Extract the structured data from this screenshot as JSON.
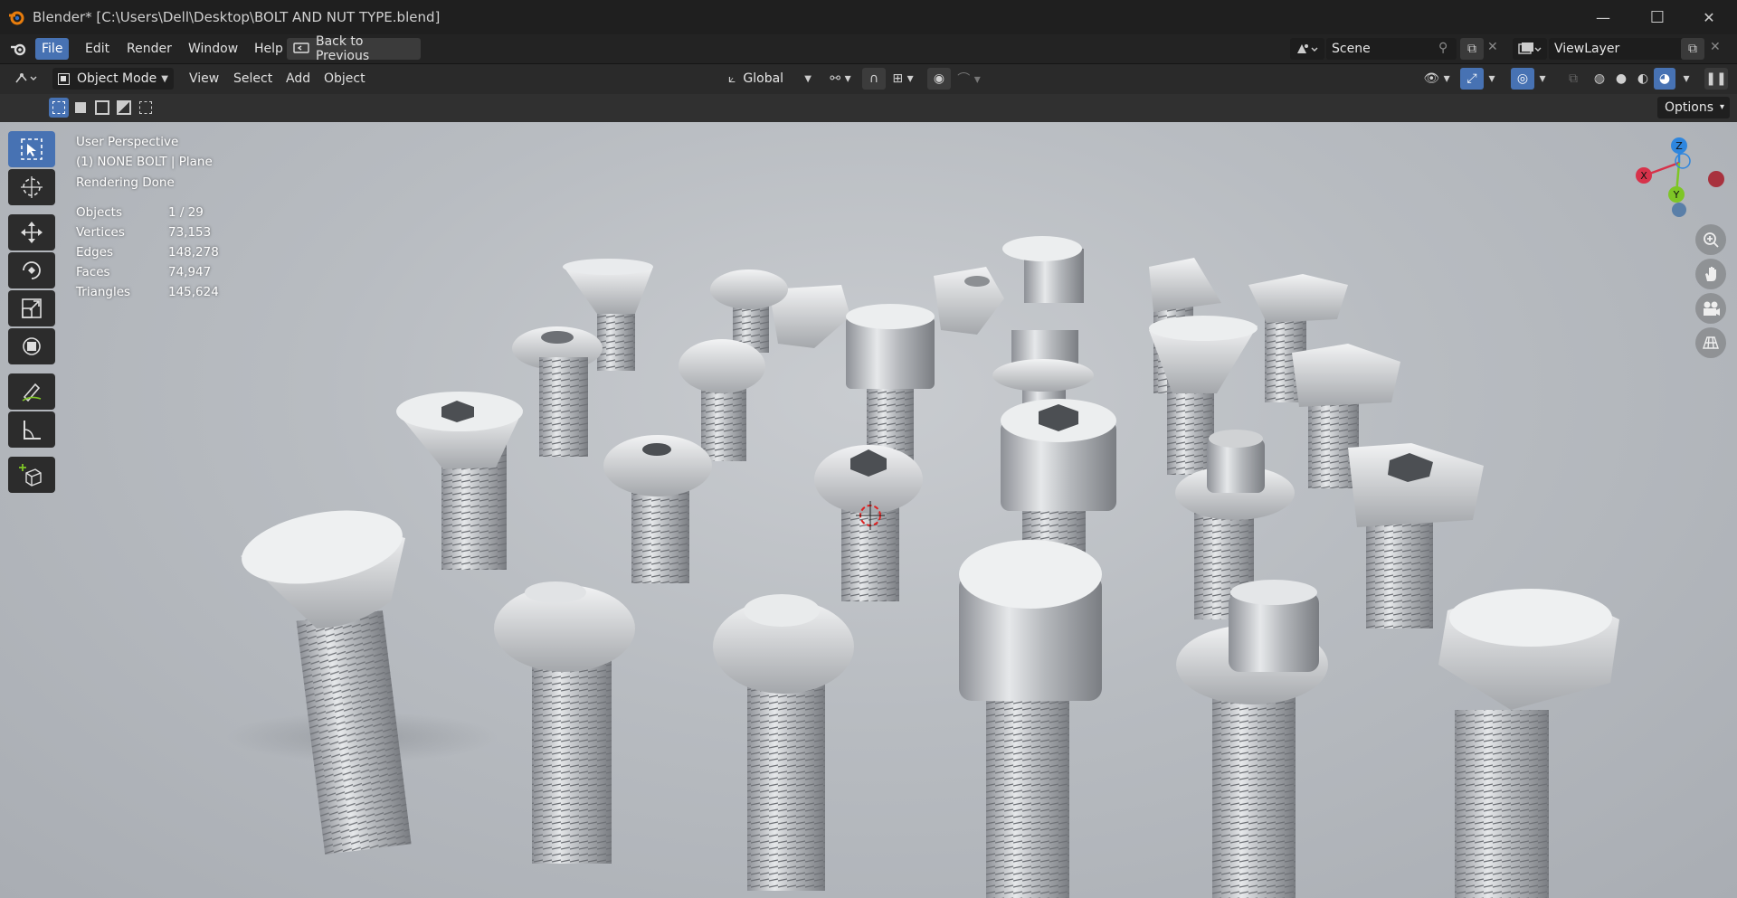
{
  "window": {
    "title": "Blender* [C:\\Users\\Dell\\Desktop\\BOLT AND NUT TYPE.blend]",
    "controls": {
      "minimize": "—",
      "maximize": "☐",
      "close": "✕"
    }
  },
  "menu": {
    "items": [
      "File",
      "Edit",
      "Render",
      "Window",
      "Help"
    ],
    "back_button": "Back to Previous",
    "scene": "Scene",
    "view_layer": "ViewLayer"
  },
  "header": {
    "mode": "Object Mode",
    "menus": [
      "View",
      "Select",
      "Add",
      "Object"
    ],
    "orientation": "Global"
  },
  "tool_header": {
    "options": "Options"
  },
  "overlay": {
    "lines": [
      "User Perspective",
      "(1) NONE BOLT | Plane",
      "Rendering Done"
    ],
    "stats": [
      {
        "label": "Objects",
        "value": "1 / 29"
      },
      {
        "label": "Vertices",
        "value": "73,153"
      },
      {
        "label": "Edges",
        "value": "148,278"
      },
      {
        "label": "Faces",
        "value": "74,947"
      },
      {
        "label": "Triangles",
        "value": "145,624"
      }
    ]
  },
  "gizmo": {
    "x": "X",
    "y": "Y",
    "z": "Z"
  },
  "colors": {
    "accent": "#4772b3",
    "axis_x": "#d7324a",
    "axis_y": "#7ec626",
    "axis_z": "#2e86de"
  },
  "icons": {
    "toolbar": [
      "select-box-icon",
      "cursor-icon",
      "move-icon",
      "rotate-icon",
      "scale-icon",
      "transform-icon",
      "annotate-icon",
      "measure-icon",
      "add-cube-icon"
    ],
    "navigation": [
      "zoom-icon",
      "hand-icon",
      "camera-icon",
      "grid-icon"
    ]
  }
}
